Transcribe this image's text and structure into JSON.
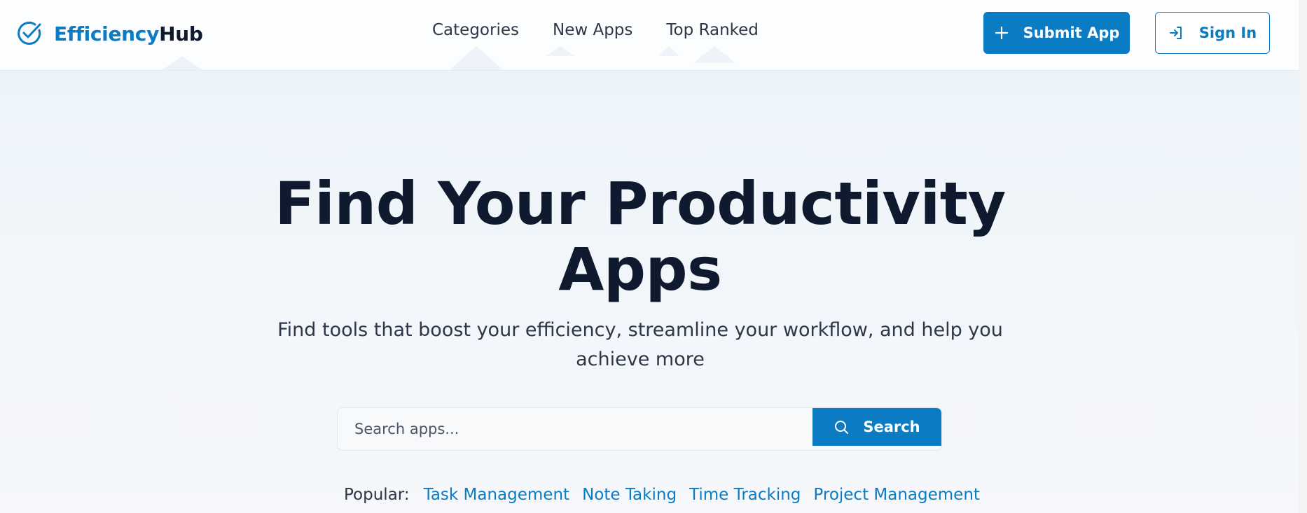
{
  "brand": {
    "name_accent": "Efficiency",
    "name_rest": "Hub",
    "accent_color": "#0b7cc3",
    "dark_color": "#0f1a2e",
    "icon": "check-circle-icon"
  },
  "nav": {
    "items": [
      {
        "label": "Categories"
      },
      {
        "label": "New Apps"
      },
      {
        "label": "Top Ranked"
      }
    ]
  },
  "actions": {
    "submit": {
      "label": "Submit App",
      "icon": "plus-icon"
    },
    "signin": {
      "label": "Sign In",
      "icon": "sign-in-icon"
    }
  },
  "hero": {
    "title_line1": "Find Your Productivity",
    "title_line2": "Apps",
    "subtitle": "Find tools that boost your efficiency, streamline your workflow, and help you achieve more"
  },
  "search": {
    "placeholder": "Search apps...",
    "value": "",
    "button_label": "Search",
    "icon": "search-icon"
  },
  "popular": {
    "label": "Popular:",
    "tags": [
      {
        "label": "Task Management"
      },
      {
        "label": "Note Taking"
      },
      {
        "label": "Time Tracking"
      },
      {
        "label": "Project Management"
      }
    ]
  }
}
